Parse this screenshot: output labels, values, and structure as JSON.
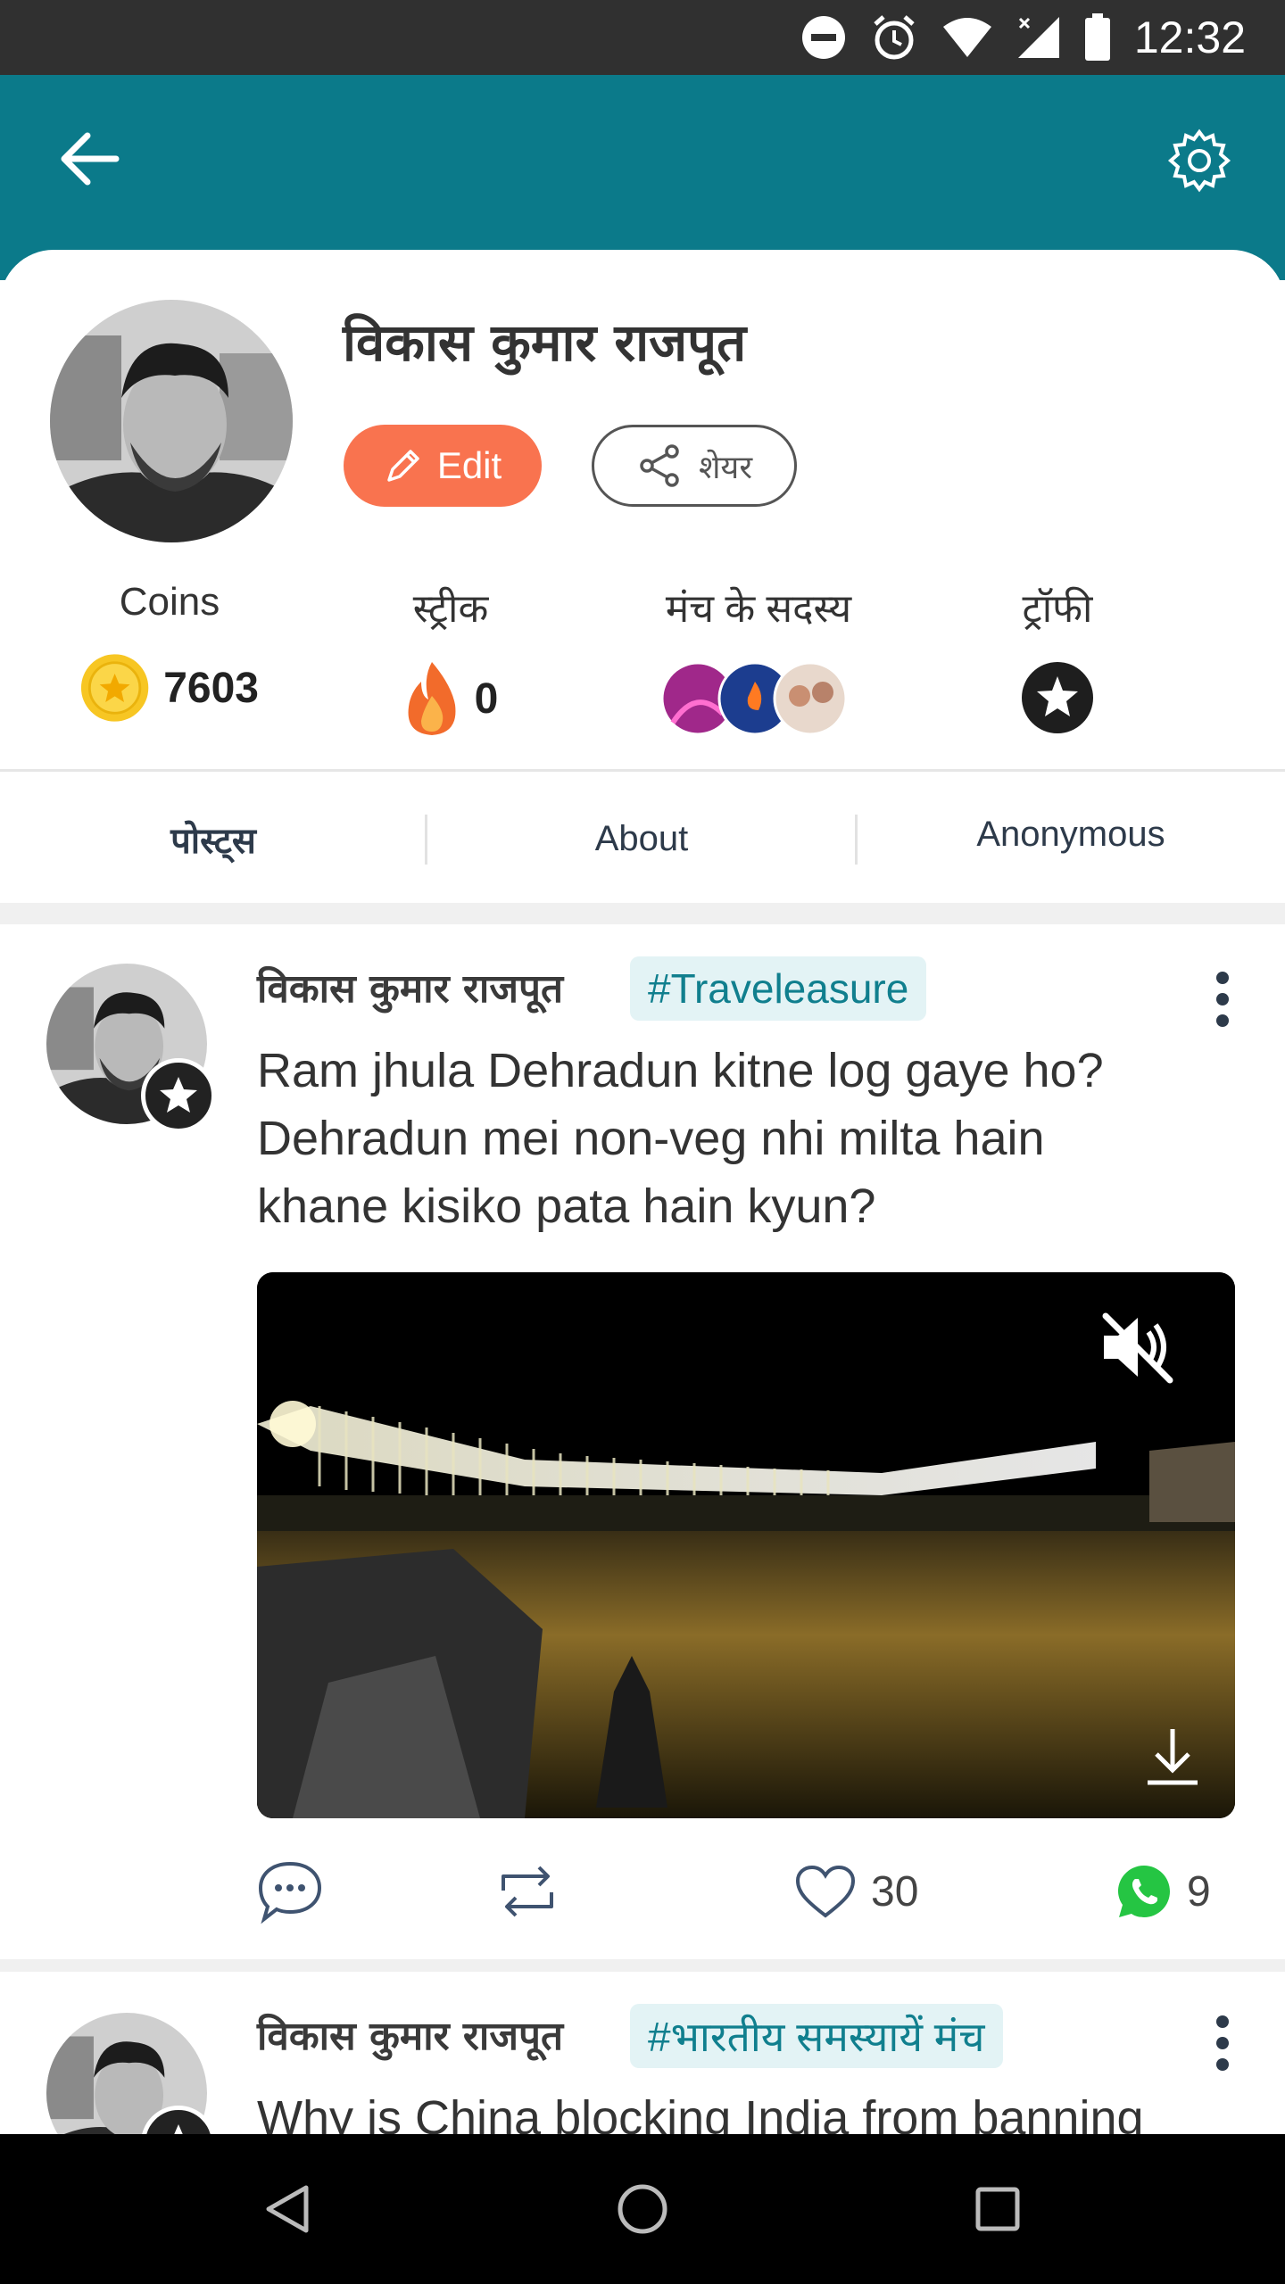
{
  "status_bar": {
    "time": "12:32",
    "icons": [
      "do-not-disturb-icon",
      "alarm-icon",
      "wifi-icon",
      "signal-icon",
      "battery-icon"
    ]
  },
  "header": {
    "back_icon": "arrow-left-icon",
    "settings_icon": "gear-icon",
    "color": "#0b7a8a"
  },
  "profile": {
    "name": "विकास कुमार राजपूत",
    "edit_label": "Edit",
    "share_label": "शेयर",
    "edit_color": "#f9734f"
  },
  "stats": [
    {
      "label": "Coins",
      "value": "7603",
      "icon": "coin-icon"
    },
    {
      "label": "स्ट्रीक",
      "value": "0",
      "icon": "flame-icon"
    },
    {
      "label": "मंच के सदस्य",
      "value": "",
      "icon": "member-avatars"
    },
    {
      "label": "ट्रॉफी",
      "value": "",
      "icon": "trophy-star-icon"
    }
  ],
  "tabs": [
    "पोस्ट्स",
    "About",
    "Anonymous"
  ],
  "posts": [
    {
      "author": "विकास कुमार राजपूत",
      "tag": "#Traveleasure",
      "text_lines": [
        "Ram jhula Dehradun kitne log gaye ho?",
        "Dehradun mei non-veg nhi milta hain",
        "khane kisiko pata hain kyun?"
      ],
      "likes": "30",
      "whatsapp_shares": "9"
    },
    {
      "author": "विकास कुमार राजपूत",
      "tag": "#भारतीय समस्यायें मंच",
      "text_lines": [
        "Why is China blocking India from banning"
      ]
    }
  ]
}
